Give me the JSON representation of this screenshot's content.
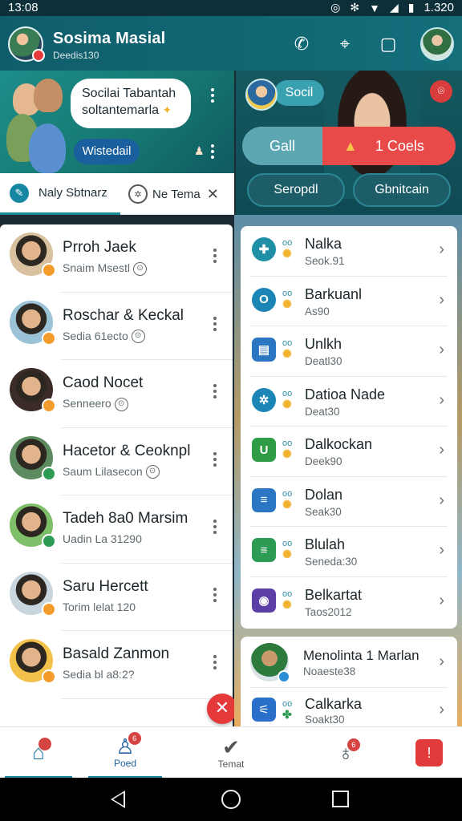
{
  "status_bar": {
    "time": "13:08",
    "battery": "1.320"
  },
  "app_bar": {
    "title": "Sosima Masial",
    "subtitle": "Deedis130"
  },
  "hero": {
    "bubble_line1": "Socilai Tabantah",
    "bubble_line2": "soltantemarla",
    "cta": "Wistedail"
  },
  "tabs": [
    {
      "label": "Naly Sbtnarz"
    },
    {
      "label": "Ne Tema"
    }
  ],
  "right_hero": {
    "chip": "Socil",
    "call": "Gall",
    "coels": "1 Coels",
    "btn_a": "Seropdl",
    "btn_b": "Gbnitcain"
  },
  "contacts": [
    {
      "name": "Prroh Jaek",
      "sub": "Snaim Msestl",
      "tag": "⊙",
      "badge_color": "#f39c2c",
      "avatar_bg": "#d9c1a0"
    },
    {
      "name": "Roschar & Keckal",
      "sub": "Sedia 61ecto",
      "tag": "⊙",
      "badge_color": "#f39c2c",
      "avatar_bg": "#9bc2d6"
    },
    {
      "name": "Caod Nocet",
      "sub": "Senneero",
      "tag": "⊙",
      "badge_color": "#f39c2c",
      "avatar_bg": "#3b2c27"
    },
    {
      "name": "Hacetor & Ceoknpl",
      "sub": "Saum Lilasecon",
      "tag": "⊙",
      "badge_color": "#2e9b55",
      "avatar_bg": "#5b8b5f"
    },
    {
      "name": "Tadeh 8a0 Marsim",
      "sub": "Uadin La 31290",
      "tag": "",
      "badge_color": "#2e9b55",
      "avatar_bg": "#7fbf6a"
    },
    {
      "name": "Saru Hercett",
      "sub": "Torim lelat 120",
      "tag": "",
      "badge_color": "#f39c2c",
      "avatar_bg": "#c9d6de"
    },
    {
      "name": "Basald Zanmon",
      "sub": "Sedia bl a8:2?",
      "tag": "",
      "badge_color": "#f39c2c",
      "avatar_bg": "#f1c14a"
    }
  ],
  "apps": [
    {
      "name": "Nalka",
      "sub": "Seok.91",
      "icon": "✚",
      "icon_bg": "#1f8fa6",
      "round": true
    },
    {
      "name": "Barkuanl",
      "sub": "As90",
      "icon": "O",
      "icon_bg": "#1b86b5",
      "round": true
    },
    {
      "name": "Unlkh",
      "sub": "Deatl30",
      "icon": "▤",
      "icon_bg": "#2a76c3",
      "round": false
    },
    {
      "name": "Datioa Nade",
      "sub": "Deat30",
      "icon": "✲",
      "icon_bg": "#1b86b5",
      "round": true
    },
    {
      "name": "Dalkockan",
      "sub": "Deek90",
      "icon": "U",
      "icon_bg": "#2e9b45",
      "round": false
    },
    {
      "name": "Dolan",
      "sub": "Seak30",
      "icon": "≡",
      "icon_bg": "#2a76c3",
      "round": false
    },
    {
      "name": "Blulah",
      "sub": "Seneda:30",
      "icon": "≡",
      "icon_bg": "#2e9b55",
      "round": false
    },
    {
      "name": "Belkartat",
      "sub": "Taos2012",
      "icon": "◉",
      "icon_bg": "#5b3fa6",
      "round": false
    }
  ],
  "card2": {
    "contact_name": "Menolinta 1 Marlan",
    "contact_sub": "Noaeste38",
    "app_name": "Calkarka",
    "app_sub": "Soakt30"
  },
  "bottom_nav": [
    {
      "label": "",
      "badge": ""
    },
    {
      "label": "Poed",
      "badge": "6"
    },
    {
      "label": "Temat",
      "badge": ""
    },
    {
      "label": "",
      "badge": "6"
    },
    {
      "label": "",
      "badge": ""
    }
  ]
}
